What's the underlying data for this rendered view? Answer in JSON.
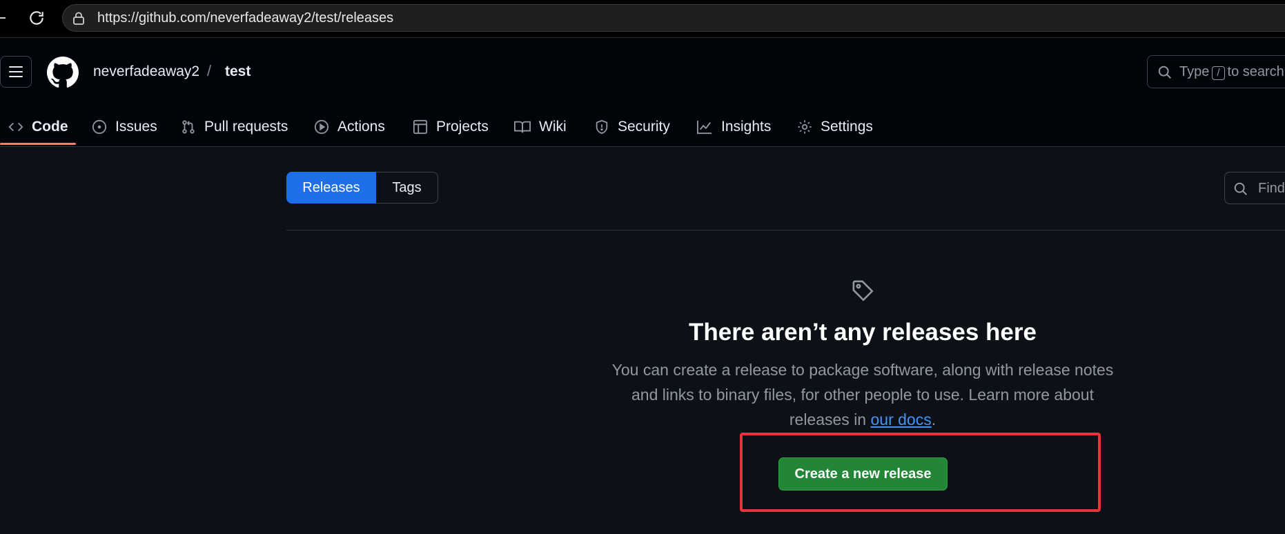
{
  "browser": {
    "url": "https://github.com/neverfadeaway2/test/releases"
  },
  "header": {
    "owner": "neverfadeaway2",
    "separator": "/",
    "repo": "test",
    "search": {
      "prefix": "Type",
      "key": "/",
      "suffix": "to search"
    }
  },
  "repo_nav": {
    "tabs": [
      {
        "label": "Code",
        "icon": "code-icon",
        "active": true
      },
      {
        "label": "Issues",
        "icon": "issue-icon"
      },
      {
        "label": "Pull requests",
        "icon": "pull-request-icon"
      },
      {
        "label": "Actions",
        "icon": "play-icon"
      },
      {
        "label": "Projects",
        "icon": "table-icon"
      },
      {
        "label": "Wiki",
        "icon": "book-icon"
      },
      {
        "label": "Security",
        "icon": "shield-icon"
      },
      {
        "label": "Insights",
        "icon": "graph-icon"
      },
      {
        "label": "Settings",
        "icon": "gear-icon"
      }
    ]
  },
  "releases_page": {
    "segmented": {
      "releases": "Releases",
      "tags": "Tags"
    },
    "find_placeholder": "Find",
    "blankslate": {
      "title": "There aren’t any releases here",
      "description": "You can create a release to package software, along with release notes and links to binary files, for other people to use. Learn more about releases in",
      "link_text": "our docs",
      "trailing": ".",
      "button": "Create a new release"
    }
  },
  "colors": {
    "accent": "#1f6feb",
    "primary_button": "#238636",
    "tab_underline": "#f78166",
    "annotation": "#e5343b",
    "link": "#4493f8"
  }
}
